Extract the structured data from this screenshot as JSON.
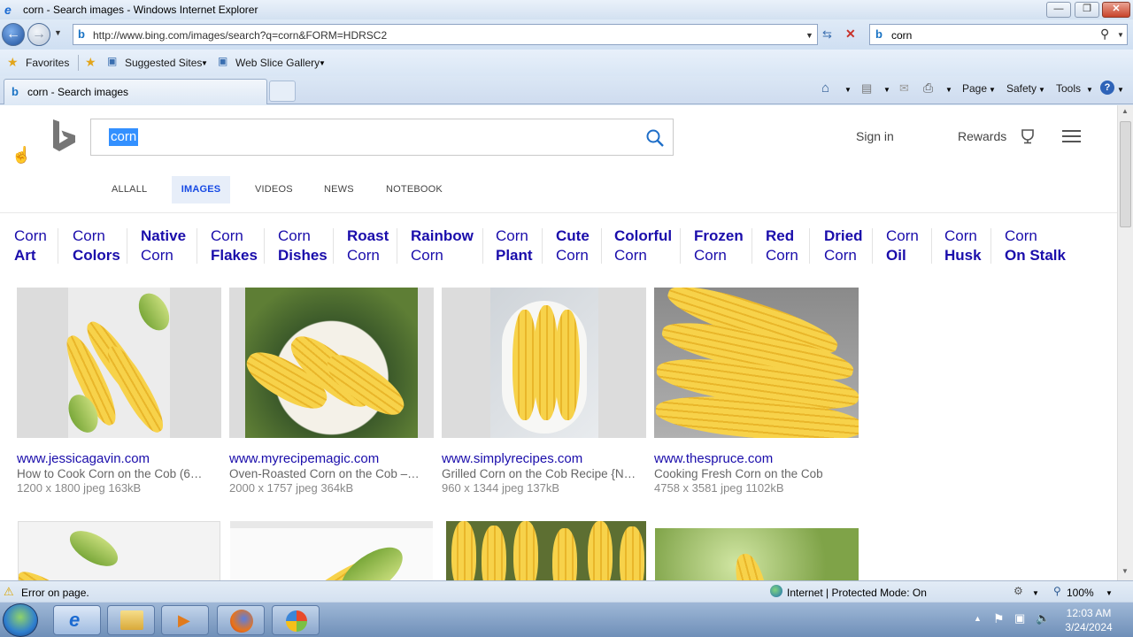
{
  "window": {
    "title": "corn - Search images - Windows Internet Explorer"
  },
  "addressbar": {
    "url": "http://www.bing.com/images/search?q=corn&FORM=HDRSC2"
  },
  "searchbar": {
    "text": "corn"
  },
  "favorites_bar": {
    "favorites": "Favorites",
    "suggested": "Suggested Sites",
    "webslice": "Web Slice Gallery"
  },
  "tab": {
    "title": "corn - Search images"
  },
  "command_bar": {
    "page": "Page",
    "safety": "Safety",
    "tools": "Tools"
  },
  "bing": {
    "query": "corn",
    "signin": "Sign in",
    "rewards": "Rewards",
    "scopes": [
      "ALLALL",
      "IMAGES",
      "VIDEOS",
      "NEWS",
      "NOTEBOOK"
    ],
    "related": [
      {
        "line1": "Corn",
        "line2": "Art",
        "bold_line": 2
      },
      {
        "line1": "Corn",
        "line2": "Colors",
        "bold_line": 2
      },
      {
        "line1": "Native",
        "line2": "Corn",
        "bold_line": 1
      },
      {
        "line1": "Corn",
        "line2": "Flakes",
        "bold_line": 2
      },
      {
        "line1": "Corn",
        "line2": "Dishes",
        "bold_line": 2
      },
      {
        "line1": "Roast",
        "line2": "Corn",
        "bold_line": 1
      },
      {
        "line1": "Rainbow",
        "line2": "Corn",
        "bold_line": 1
      },
      {
        "line1": "Corn",
        "line2": "Plant",
        "bold_line": 2
      },
      {
        "line1": "Cute",
        "line2": "Corn",
        "bold_line": 1
      },
      {
        "line1": "Colorful",
        "line2": "Corn",
        "bold_line": 1
      },
      {
        "line1": "Frozen",
        "line2": "Corn",
        "bold_line": 1
      },
      {
        "line1": "Red",
        "line2": "Corn",
        "bold_line": 1
      },
      {
        "line1": "Dried",
        "line2": "Corn",
        "bold_line": 1
      },
      {
        "line1": "Corn",
        "line2": "Oil",
        "bold_line": 2
      },
      {
        "line1": "Corn",
        "line2": "Husk",
        "bold_line": 2
      },
      {
        "line1": "Corn",
        "line2": "On Stalk",
        "bold_line": 2
      }
    ],
    "results": [
      {
        "site": "www.jessicagavin.com",
        "caption": "How to Cook Corn on the Cob (6…",
        "meta": "1200 x 1800 jpeg 163kB"
      },
      {
        "site": "www.myrecipemagic.com",
        "caption": "Oven-Roasted Corn on the Cob –…",
        "meta": "2000 x 1757 jpeg 364kB"
      },
      {
        "site": "www.simplyrecipes.com",
        "caption": "Grilled Corn on the Cob Recipe {N…",
        "meta": "960 x 1344 jpeg 137kB"
      },
      {
        "site": "www.thespruce.com",
        "caption": "Cooking Fresh Corn on the Cob",
        "meta": "4758 x 3581 jpeg 1102kB"
      }
    ]
  },
  "statusbar": {
    "message": "Error on page.",
    "zone": "Internet | Protected Mode: On",
    "zoom": "100%"
  },
  "clock": {
    "time": "12:03 AM",
    "date": "3/24/2024"
  }
}
